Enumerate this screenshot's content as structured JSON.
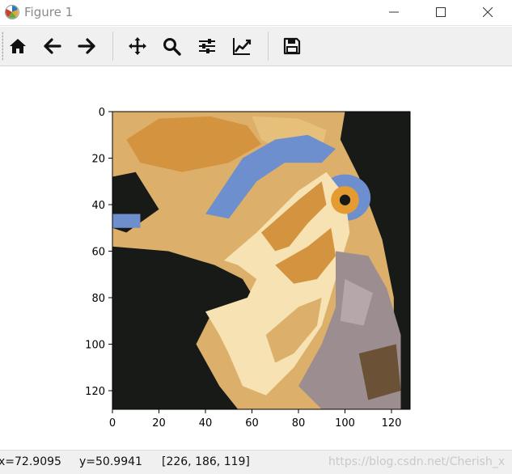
{
  "window": {
    "title": "Figure 1",
    "icon": "matplotlib-icon",
    "controls": [
      "minimize-icon",
      "maximize-icon",
      "close-icon"
    ]
  },
  "toolbar": {
    "items": [
      {
        "name": "home",
        "icon": "home-icon"
      },
      {
        "name": "back",
        "icon": "arrow-left-icon"
      },
      {
        "name": "forward",
        "icon": "arrow-right-icon"
      },
      {
        "name": "pan",
        "icon": "move-icon"
      },
      {
        "name": "zoom",
        "icon": "zoom-icon"
      },
      {
        "name": "subplots",
        "icon": "sliders-icon"
      },
      {
        "name": "customize",
        "icon": "chart-line-icon"
      },
      {
        "name": "save",
        "icon": "save-icon"
      }
    ]
  },
  "chart_data": {
    "type": "heatmap",
    "description_of_values": "quantized RGB image (128x128 pixels, few-color palette)",
    "xlim": [
      0,
      128
    ],
    "ylim": [
      128,
      0
    ],
    "xticks": [
      "0",
      "20",
      "40",
      "60",
      "80",
      "100",
      "120"
    ],
    "yticks": [
      "0",
      "20",
      "40",
      "60",
      "80",
      "100",
      "120"
    ],
    "palette": {
      "dark": "#181a17",
      "tan": "#dcb06b",
      "tan_light": "#e6c07a",
      "orange": "#d4943f",
      "cream": "#f6e2b2",
      "blue": "#6e8fce",
      "blue_dark": "#4e6fa8",
      "gray": "#9c8e90",
      "gray_light": "#b6a8aa",
      "brown": "#6b5135",
      "eye": "#e39b32"
    }
  },
  "status": {
    "x": "x=72.9095",
    "y": "y=50.9941",
    "rgb": "[226, 186, 119]",
    "watermark": "https://blog.csdn.net/Cherish_x"
  }
}
